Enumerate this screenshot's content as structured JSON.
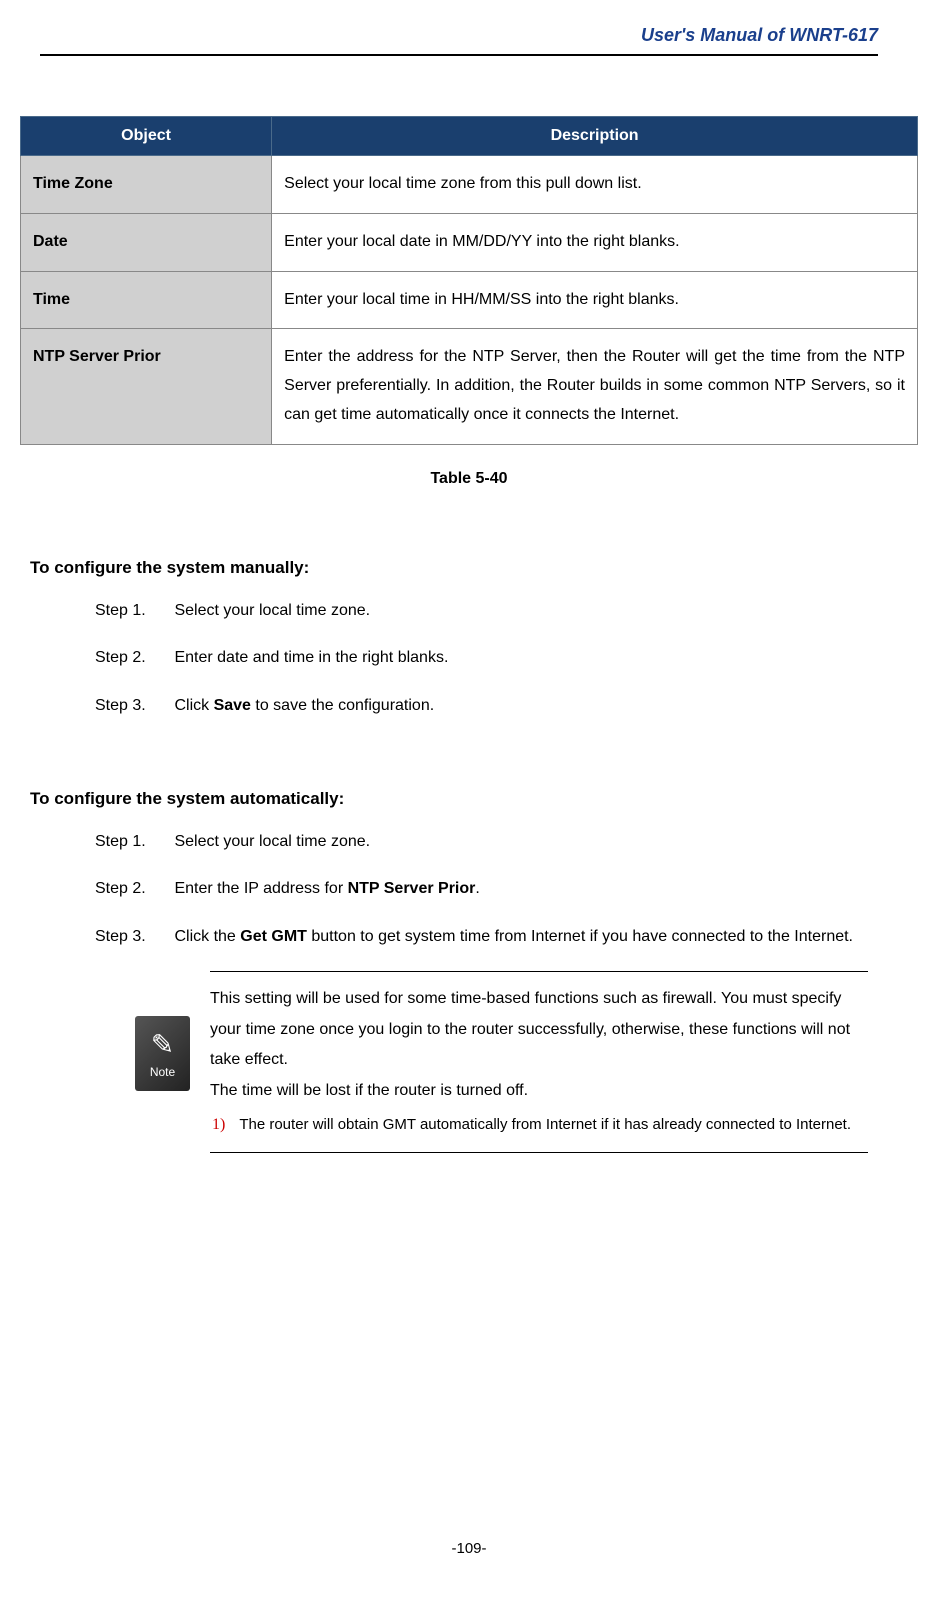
{
  "header": {
    "title": "User's Manual of WNRT-617"
  },
  "table": {
    "headers": {
      "object": "Object",
      "description": "Description"
    },
    "rows": [
      {
        "object": "Time Zone",
        "description": "Select your local time zone from this pull down list."
      },
      {
        "object": "Date",
        "description": "Enter your local date in MM/DD/YY into the right blanks."
      },
      {
        "object": "Time",
        "description": "Enter your local time in HH/MM/SS into the right blanks."
      },
      {
        "object": "NTP Server Prior",
        "description": "Enter the address for the NTP Server, then the Router will get the time from the NTP Server preferentially. In addition, the Router builds in some common NTP Servers, so it can get time automatically once it connects the Internet."
      }
    ],
    "caption": "Table 5-40"
  },
  "section1": {
    "heading": "To configure the system manually:",
    "steps": {
      "s1_label": "Step 1.",
      "s1_text": "Select your local time zone.",
      "s2_label": "Step 2.",
      "s2_text": "Enter date and time in the right blanks.",
      "s3_label": "Step 3.",
      "s3_pre": "Click ",
      "s3_bold": "Save",
      "s3_post": " to save the configuration."
    }
  },
  "section2": {
    "heading": "To configure the system automatically:",
    "steps": {
      "s1_label": "Step 1.",
      "s1_text": "Select your local time zone.",
      "s2_label": "Step 2.",
      "s2_pre": "Enter the IP address for ",
      "s2_bold": "NTP Server Prior",
      "s2_post": ".",
      "s3_label": "Step 3.",
      "s3_pre": "Click the ",
      "s3_bold": "Get GMT",
      "s3_post": " button to get system time from Internet if you have connected to the Internet."
    }
  },
  "note": {
    "icon_label": "Note",
    "p1": "This setting will be used for some time-based functions such as firewall. You must specify your time zone once you login to the router successfully, otherwise, these functions will not take effect.",
    "p2": "The time will be lost if the router is turned off.",
    "item1_num": "1)",
    "item1_text": "The router will obtain GMT automatically from Internet if it has already connected to Internet."
  },
  "footer": {
    "page": "-109-"
  }
}
